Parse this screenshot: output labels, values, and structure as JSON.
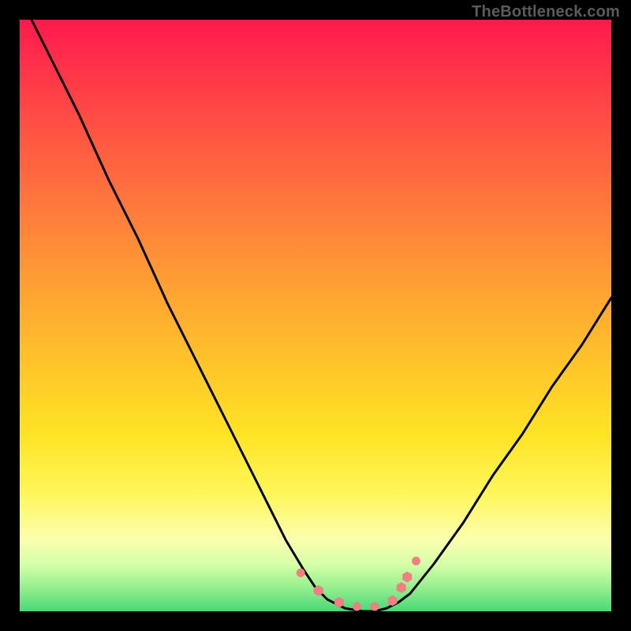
{
  "watermark": "TheBottleneck.com",
  "chart_data": {
    "type": "line",
    "title": "",
    "xlabel": "",
    "ylabel": "",
    "xlim": [
      0,
      100
    ],
    "ylim": [
      0,
      100
    ],
    "grid": false,
    "legend": false,
    "background_gradient_meaning": "bottleneck percentage heat (red=high, green=low)",
    "curve_description": "V-shaped bottleneck curve reaching minimum (~0) near x≈55–62",
    "x": [
      0,
      5,
      10,
      15,
      20,
      25,
      30,
      35,
      40,
      45,
      48,
      50,
      52,
      55,
      58,
      60,
      62,
      64,
      66,
      70,
      75,
      80,
      85,
      90,
      95,
      100
    ],
    "values": [
      104,
      94,
      84,
      73,
      63,
      52,
      42,
      32,
      22,
      12,
      7,
      4,
      2,
      0.5,
      0,
      0,
      0.5,
      1.5,
      3,
      8,
      15,
      23,
      30,
      38,
      45,
      53
    ],
    "markers": {
      "description": "pink dot/hex markers along curve floor",
      "points_xy": [
        [
          47.5,
          6.5
        ],
        [
          50.5,
          3.5
        ],
        [
          54,
          1.5
        ],
        [
          57,
          0.8
        ],
        [
          60,
          0.8
        ],
        [
          63,
          1.8
        ],
        [
          64.5,
          4.0
        ],
        [
          65.5,
          5.8
        ],
        [
          67,
          8.5
        ]
      ],
      "color": "#ef7f80",
      "size": 9
    }
  }
}
